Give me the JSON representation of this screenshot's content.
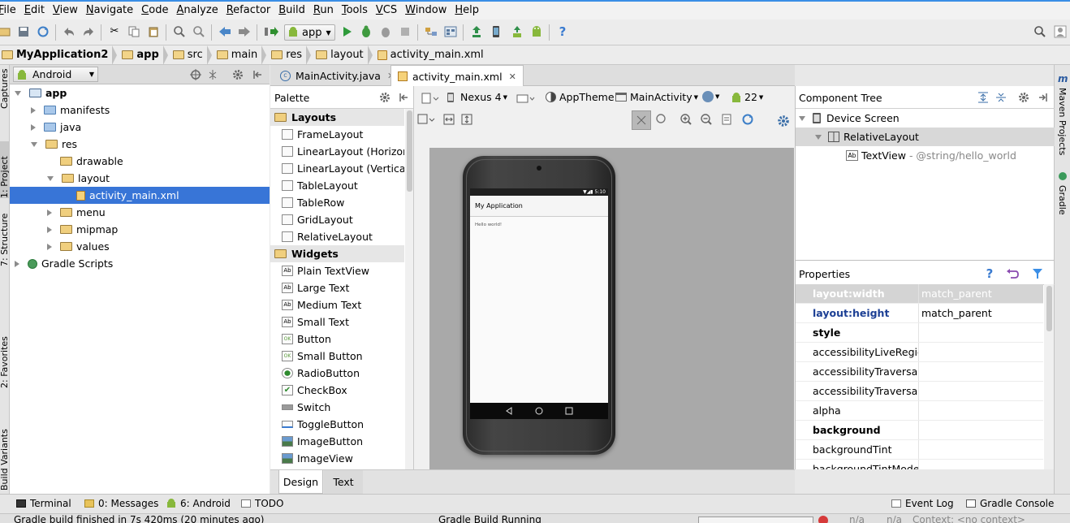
{
  "menu": [
    "File",
    "Edit",
    "View",
    "Navigate",
    "Code",
    "Analyze",
    "Refactor",
    "Build",
    "Run",
    "Tools",
    "VCS",
    "Window",
    "Help"
  ],
  "toolbar": {
    "run_config": "app"
  },
  "breadcrumb": [
    "MyApplication2",
    "app",
    "src",
    "main",
    "res",
    "layout",
    "activity_main.xml"
  ],
  "side_left": {
    "captures": "Captures",
    "project": "1: Project",
    "structure": "7: Structure",
    "favorites": "2: Favorites",
    "build_variants": "Build Variants"
  },
  "side_right": {
    "maven": "Maven Projects",
    "gradle": "Gradle"
  },
  "project": {
    "view": "Android",
    "tree": [
      {
        "label": "app",
        "level": 0,
        "open": true,
        "bold": true
      },
      {
        "label": "manifests",
        "level": 1,
        "open": false
      },
      {
        "label": "java",
        "level": 1,
        "open": false
      },
      {
        "label": "res",
        "level": 1,
        "open": true
      },
      {
        "label": "drawable",
        "level": 2,
        "open": null
      },
      {
        "label": "layout",
        "level": 2,
        "open": true
      },
      {
        "label": "activity_main.xml",
        "level": 3,
        "selected": true
      },
      {
        "label": "menu",
        "level": 2,
        "open": false
      },
      {
        "label": "mipmap",
        "level": 2,
        "open": false
      },
      {
        "label": "values",
        "level": 2,
        "open": false
      },
      {
        "label": "Gradle Scripts",
        "level": 0,
        "open": false
      }
    ]
  },
  "tabs": [
    {
      "label": "MainActivity.java",
      "active": false
    },
    {
      "label": "activity_main.xml",
      "active": true
    }
  ],
  "palette": {
    "title": "Palette",
    "layouts_header": "Layouts",
    "layouts": [
      "FrameLayout",
      "LinearLayout (Horizontal)",
      "LinearLayout (Vertical)",
      "TableLayout",
      "TableRow",
      "GridLayout",
      "RelativeLayout"
    ],
    "widgets_header": "Widgets",
    "widgets": [
      "Plain TextView",
      "Large Text",
      "Medium Text",
      "Small Text",
      "Button",
      "Small Button",
      "RadioButton",
      "CheckBox",
      "Switch",
      "ToggleButton",
      "ImageButton",
      "ImageView"
    ]
  },
  "designer": {
    "device": "Nexus 4",
    "theme": "AppTheme",
    "activity": "MainActivity",
    "api": "22"
  },
  "phone": {
    "time": "5:10",
    "app_title": "My Application",
    "content": "Hello world!"
  },
  "design_tabs": {
    "design": "Design",
    "text": "Text"
  },
  "component_tree": {
    "title": "Component Tree",
    "device": "Device Screen",
    "layout": "RelativeLayout",
    "textview": "TextView",
    "textview_hint": "- @string/hello_world"
  },
  "properties": {
    "title": "Properties",
    "rows": [
      {
        "key": "layout:width",
        "value": "match_parent",
        "style": "selected"
      },
      {
        "key": "layout:height",
        "value": "match_parent",
        "style": "blue"
      },
      {
        "key": "style",
        "value": "",
        "style": "bold"
      },
      {
        "key": "accessibilityLiveRegion",
        "value": "",
        "style": ""
      },
      {
        "key": "accessibilityTraversalAfter",
        "value": "",
        "style": ""
      },
      {
        "key": "accessibilityTraversalBefore",
        "value": "",
        "style": ""
      },
      {
        "key": "alpha",
        "value": "",
        "style": ""
      },
      {
        "key": "background",
        "value": "",
        "style": "bold"
      },
      {
        "key": "backgroundTint",
        "value": "",
        "style": ""
      },
      {
        "key": "backgroundTintMode",
        "value": "",
        "style": ""
      }
    ]
  },
  "toolwindows": {
    "terminal": "Terminal",
    "messages": "0: Messages",
    "android": "6: Android",
    "todo": "TODO",
    "event_log": "Event Log",
    "gradle_console": "Gradle Console"
  },
  "status": {
    "message": "Gradle build finished in 7s 420ms (20 minutes ago)",
    "task": "Gradle Build Running",
    "pos1": "n/a",
    "pos2": "n/a",
    "context": "Context: <no context>"
  },
  "colors": {
    "selection": "#3875d7",
    "accent": "#3a8ee6",
    "blue_key": "#1c3f94"
  }
}
